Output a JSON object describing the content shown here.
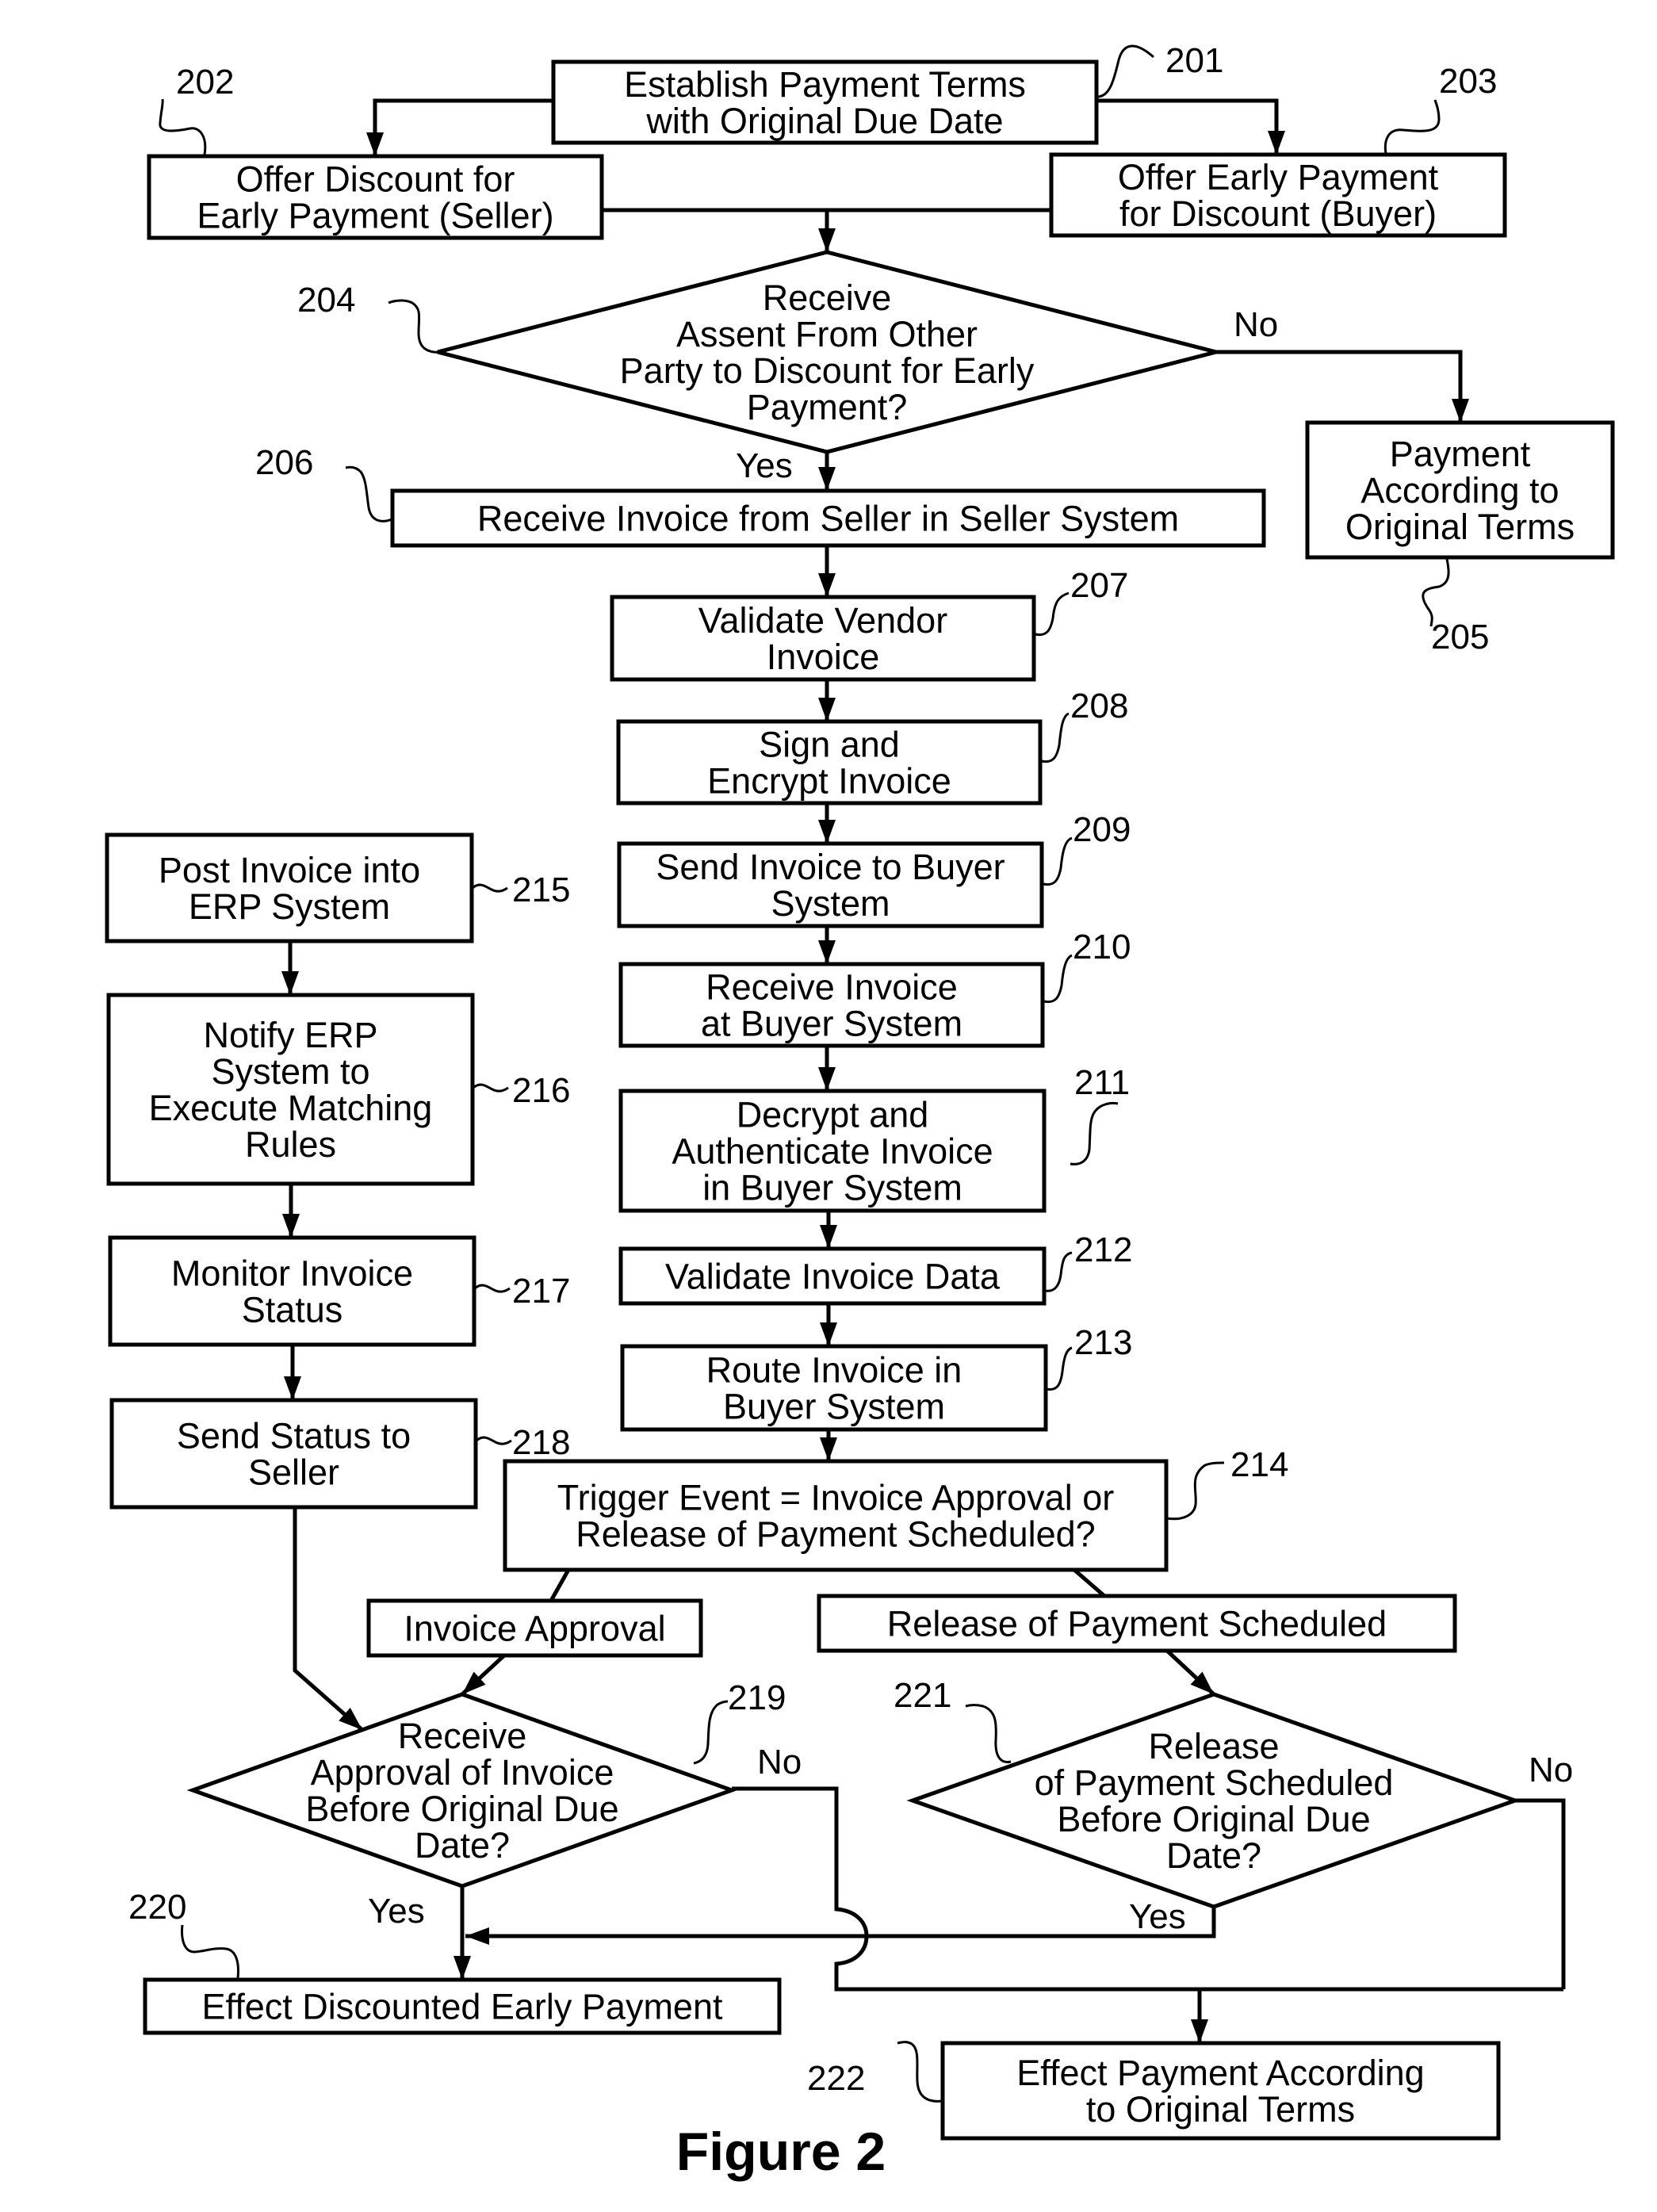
{
  "figure": {
    "caption": "Figure 2",
    "colors": {
      "ink": "#000000",
      "paper": "#ffffff"
    }
  },
  "nodes": {
    "n201": {
      "ref": "201",
      "type": "process",
      "lines": [
        "Establish Payment Terms",
        "with Original Due Date"
      ]
    },
    "n202": {
      "ref": "202",
      "type": "process",
      "lines": [
        "Offer Discount for",
        "Early Payment (Seller)"
      ]
    },
    "n203": {
      "ref": "203",
      "type": "process",
      "lines": [
        "Offer Early Payment",
        "for Discount (Buyer)"
      ]
    },
    "n204": {
      "ref": "204",
      "type": "decision",
      "lines": [
        "Receive",
        "Assent From Other",
        "Party to Discount for Early",
        "Payment?"
      ]
    },
    "n205": {
      "ref": "205",
      "type": "process",
      "lines": [
        "Payment",
        "According to",
        "Original Terms"
      ]
    },
    "n206": {
      "ref": "206",
      "type": "process",
      "lines": [
        "Receive Invoice from Seller in Seller System"
      ]
    },
    "n207": {
      "ref": "207",
      "type": "process",
      "lines": [
        "Validate Vendor",
        "Invoice"
      ]
    },
    "n208": {
      "ref": "208",
      "type": "process",
      "lines": [
        "Sign and",
        "Encrypt Invoice"
      ]
    },
    "n209": {
      "ref": "209",
      "type": "process",
      "lines": [
        "Send Invoice to Buyer",
        "System"
      ]
    },
    "n210": {
      "ref": "210",
      "type": "process",
      "lines": [
        "Receive Invoice",
        "at Buyer System"
      ]
    },
    "n211": {
      "ref": "211",
      "type": "process",
      "lines": [
        "Decrypt and",
        "Authenticate Invoice",
        "in Buyer System"
      ]
    },
    "n212": {
      "ref": "212",
      "type": "process",
      "lines": [
        "Validate Invoice Data"
      ]
    },
    "n213": {
      "ref": "213",
      "type": "process",
      "lines": [
        "Route Invoice in",
        "Buyer System"
      ]
    },
    "n214": {
      "ref": "214",
      "type": "process",
      "lines": [
        "Trigger Event = Invoice Approval or",
        "Release of Payment Scheduled?"
      ]
    },
    "n215": {
      "ref": "215",
      "type": "process",
      "lines": [
        "Post Invoice into",
        "ERP System"
      ]
    },
    "n216": {
      "ref": "216",
      "type": "process",
      "lines": [
        "Notify ERP",
        "System to",
        "Execute Matching",
        "Rules"
      ]
    },
    "n217": {
      "ref": "217",
      "type": "process",
      "lines": [
        "Monitor Invoice",
        "Status"
      ]
    },
    "n218": {
      "ref": "218",
      "type": "process",
      "lines": [
        "Send Status to",
        "Seller"
      ]
    },
    "nInvoiceApproval": {
      "ref": "",
      "type": "branch",
      "lines": [
        "Invoice Approval"
      ]
    },
    "nReleaseScheduled": {
      "ref": "",
      "type": "branch",
      "lines": [
        "Release of Payment Scheduled"
      ]
    },
    "n219": {
      "ref": "219",
      "type": "decision",
      "lines": [
        "Receive",
        "Approval of Invoice",
        "Before Original Due",
        "Date?"
      ]
    },
    "n220": {
      "ref": "220",
      "type": "process",
      "lines": [
        "Effect Discounted Early Payment"
      ]
    },
    "n221": {
      "ref": "221",
      "type": "decision",
      "lines": [
        "Release",
        "of Payment Scheduled",
        "Before Original Due",
        "Date?"
      ]
    },
    "n222": {
      "ref": "222",
      "type": "process",
      "lines": [
        "Effect Payment According",
        "to Original Terms"
      ]
    }
  },
  "edge_labels": {
    "d204_no": "No",
    "d204_yes": "Yes",
    "d219_no": "No",
    "d219_yes": "Yes",
    "d221_no": "No",
    "d221_yes": "Yes"
  },
  "edges": [
    {
      "from": "n201",
      "to": "n202"
    },
    {
      "from": "n201",
      "to": "n203"
    },
    {
      "from": "n202",
      "to": "n204"
    },
    {
      "from": "n203",
      "to": "n204"
    },
    {
      "from": "n204",
      "to": "n205",
      "label": "No"
    },
    {
      "from": "n204",
      "to": "n206",
      "label": "Yes"
    },
    {
      "from": "n206",
      "to": "n207"
    },
    {
      "from": "n207",
      "to": "n208"
    },
    {
      "from": "n208",
      "to": "n209"
    },
    {
      "from": "n209",
      "to": "n210"
    },
    {
      "from": "n210",
      "to": "n211"
    },
    {
      "from": "n211",
      "to": "n212"
    },
    {
      "from": "n212",
      "to": "n213"
    },
    {
      "from": "n213",
      "to": "n214"
    },
    {
      "from": "n214",
      "to": "nInvoiceApproval"
    },
    {
      "from": "n214",
      "to": "nReleaseScheduled"
    },
    {
      "from": "nInvoiceApproval",
      "to": "n219"
    },
    {
      "from": "nReleaseScheduled",
      "to": "n221"
    },
    {
      "from": "n215",
      "to": "n216"
    },
    {
      "from": "n216",
      "to": "n217"
    },
    {
      "from": "n217",
      "to": "n218"
    },
    {
      "from": "n218",
      "to": "n219"
    },
    {
      "from": "n219",
      "to": "n220",
      "label": "Yes"
    },
    {
      "from": "n219",
      "to": "n222",
      "label": "No"
    },
    {
      "from": "n221",
      "to": "n220",
      "label": "Yes"
    },
    {
      "from": "n221",
      "to": "n222",
      "label": "No"
    }
  ]
}
